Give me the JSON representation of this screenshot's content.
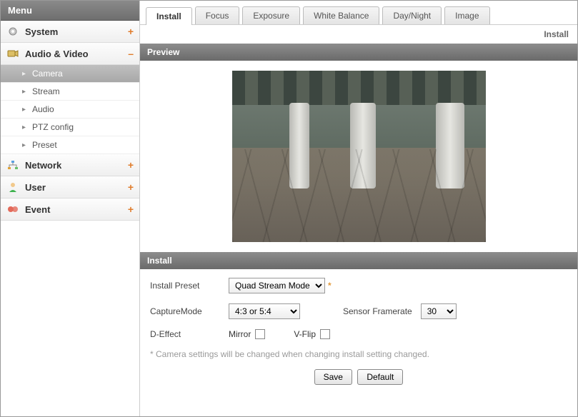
{
  "sidebar": {
    "title": "Menu",
    "sections": [
      {
        "label": "System",
        "expand": "+"
      },
      {
        "label": "Audio & Video",
        "expand": "–"
      },
      {
        "label": "Network",
        "expand": "+"
      },
      {
        "label": "User",
        "expand": "+"
      },
      {
        "label": "Event",
        "expand": "+"
      }
    ],
    "av_items": [
      {
        "label": "Camera",
        "active": true
      },
      {
        "label": "Stream"
      },
      {
        "label": "Audio"
      },
      {
        "label": "PTZ config"
      },
      {
        "label": "Preset"
      }
    ]
  },
  "tabs": [
    {
      "label": "Install",
      "active": true
    },
    {
      "label": "Focus"
    },
    {
      "label": "Exposure"
    },
    {
      "label": "White Balance"
    },
    {
      "label": "Day/Night"
    },
    {
      "label": "Image"
    }
  ],
  "breadcrumb": "Install",
  "panels": {
    "preview": "Preview",
    "install": "Install"
  },
  "form": {
    "install_preset_label": "Install Preset",
    "install_preset_value": "Quad Stream Mode",
    "capture_mode_label": "CaptureMode",
    "capture_mode_value": "4:3 or 5:4",
    "sensor_framerate_label": "Sensor Framerate",
    "sensor_framerate_value": "30",
    "d_effect_label": "D-Effect",
    "mirror_label": "Mirror",
    "vflip_label": "V-Flip",
    "note": "* Camera settings will be changed when changing install setting changed.",
    "save": "Save",
    "default": "Default"
  }
}
